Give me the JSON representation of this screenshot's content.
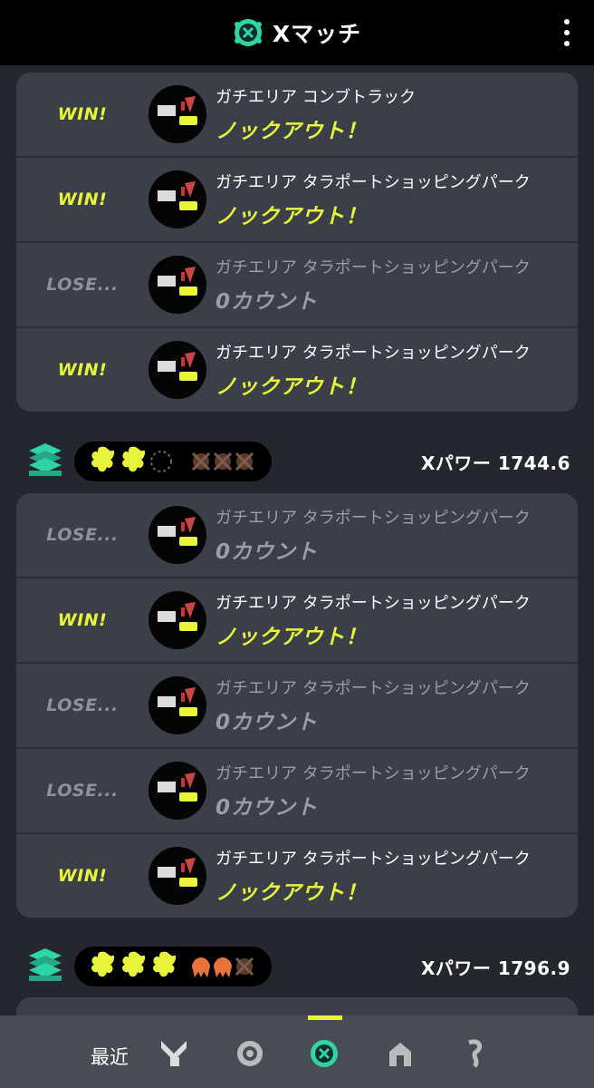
{
  "header": {
    "title": "Xマッチ",
    "accent": "#2fd4a8"
  },
  "groups": [
    {
      "matches": [
        {
          "result": "WIN!",
          "stage": "ガチエリア コンブトラック",
          "outcome": "ノックアウト！"
        },
        {
          "result": "WIN!",
          "stage": "ガチエリア タラポートショッピングパーク",
          "outcome": "ノックアウト！"
        },
        {
          "result": "LOSE...",
          "stage": "ガチエリア タラポートショッピングパーク",
          "outcome": "0カウント"
        },
        {
          "result": "WIN!",
          "stage": "ガチエリア タラポートショッピングパーク",
          "outcome": "ノックアウト！"
        }
      ]
    },
    {
      "xpower": "Xパワー 1744.6",
      "matches": [
        {
          "result": "LOSE...",
          "stage": "ガチエリア タラポートショッピングパーク",
          "outcome": "0カウント"
        },
        {
          "result": "WIN!",
          "stage": "ガチエリア タラポートショッピングパーク",
          "outcome": "ノックアウト！"
        },
        {
          "result": "LOSE...",
          "stage": "ガチエリア タラポートショッピングパーク",
          "outcome": "0カウント"
        },
        {
          "result": "LOSE...",
          "stage": "ガチエリア タラポートショッピングパーク",
          "outcome": "0カウント"
        },
        {
          "result": "WIN!",
          "stage": "ガチエリア タラポートショッピングパーク",
          "outcome": "ノックアウト！"
        }
      ]
    },
    {
      "xpower": "Xパワー 1796.9"
    }
  ],
  "nav": {
    "label": "最近",
    "icons": [
      "weapons-icon",
      "ranked-icon",
      "x-match-icon",
      "event-icon",
      "private-icon"
    ]
  },
  "colors": {
    "win": "#e8f43a",
    "lose": "#8d929b",
    "loss_mark": "#e8733a"
  }
}
